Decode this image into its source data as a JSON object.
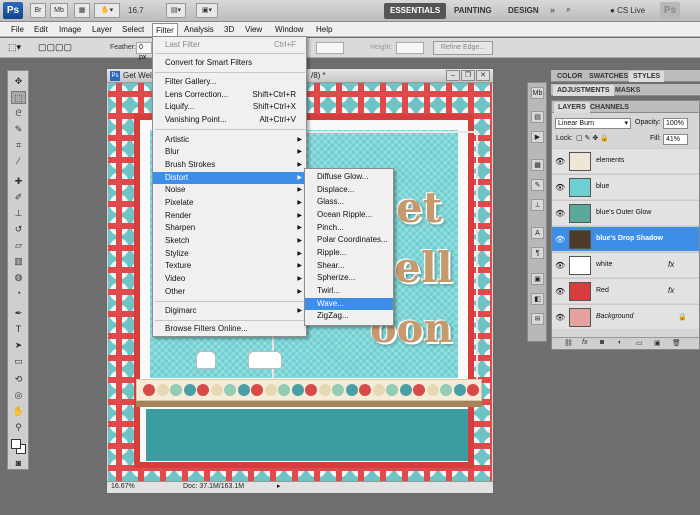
{
  "appbar": {
    "logo": "Ps",
    "br": "Br",
    "mb": "Mb",
    "zoom": "16.7",
    "workspaces": [
      "ESSENTIALS",
      "PAINTING",
      "DESIGN"
    ],
    "cslive": "CS Live"
  },
  "menubar": [
    "File",
    "Edit",
    "Image",
    "Layer",
    "Select",
    "Filter",
    "Analysis",
    "3D",
    "View",
    "Window",
    "Help"
  ],
  "options": {
    "feather_label": "Feather:",
    "feather_value": "0 px",
    "height_label": "Height:",
    "refine": "Refine Edge..."
  },
  "document": {
    "title": "Get Wel",
    "title_tail": "/8) *",
    "words": [
      "et",
      "ell",
      "oon"
    ],
    "zoom": "16.67%",
    "status": "Doc: 37.1M/163.1M",
    "dot_colors": [
      "#d64a4a",
      "#e7d8b4",
      "#93cbb4",
      "#4a9fa6",
      "#d64a4a",
      "#e7d8b4",
      "#93cbb4",
      "#4a9fa6",
      "#d64a4a",
      "#e7d8b4",
      "#93cbb4",
      "#4a9fa6",
      "#d64a4a",
      "#e7d8b4",
      "#93cbb4",
      "#4a9fa6",
      "#d64a4a",
      "#e7d8b4",
      "#93cbb4",
      "#4a9fa6",
      "#d64a4a",
      "#e7d8b4",
      "#93cbb4",
      "#4a9fa6",
      "#d64a4a"
    ]
  },
  "filter_menu": {
    "last_filter": "Last Filter",
    "last_filter_sc": "Ctrl+F",
    "smart": "Convert for Smart Filters",
    "gallery": "Filter Gallery...",
    "lens": "Lens Correction...",
    "lens_sc": "Shift+Ctrl+R",
    "liquify": "Liquify...",
    "liquify_sc": "Shift+Ctrl+X",
    "vanishing": "Vanishing Point...",
    "vanishing_sc": "Alt+Ctrl+V",
    "submenus": [
      "Artistic",
      "Blur",
      "Brush Strokes",
      "Distort",
      "Noise",
      "Pixelate",
      "Render",
      "Sharpen",
      "Sketch",
      "Stylize",
      "Texture",
      "Video",
      "Other"
    ],
    "digimarc": "Digimarc",
    "browse": "Browse Filters Online..."
  },
  "distort_menu": [
    "Diffuse Glow...",
    "Displace...",
    "Glass...",
    "Ocean Ripple...",
    "Pinch...",
    "Polar Coordinates...",
    "Ripple...",
    "Shear...",
    "Spherize...",
    "Twirl...",
    "Wave...",
    "ZigZag..."
  ],
  "panels": {
    "top_tabs": [
      "COLOR",
      "SWATCHES",
      "STYLES"
    ],
    "mid_tabs": [
      "ADJUSTMENTS",
      "MASKS"
    ],
    "layer_tabs": [
      "LAYERS",
      "CHANNELS"
    ],
    "blend_mode": "Linear Burn",
    "opacity_label": "Opacity:",
    "opacity": "100%",
    "lock_label": "Lock:",
    "fill_label": "Fill:",
    "fill": "41%",
    "layers": [
      {
        "name": "elements",
        "fx": ""
      },
      {
        "name": "blue",
        "fx": ""
      },
      {
        "name": "blue's Outer Glow",
        "fx": ""
      },
      {
        "name": "blue's Drop Shadow",
        "fx": ""
      },
      {
        "name": "white",
        "fx": "fx"
      },
      {
        "name": "Red",
        "fx": "fx"
      },
      {
        "name": "Background",
        "fx": ""
      }
    ],
    "footer": "fx"
  }
}
